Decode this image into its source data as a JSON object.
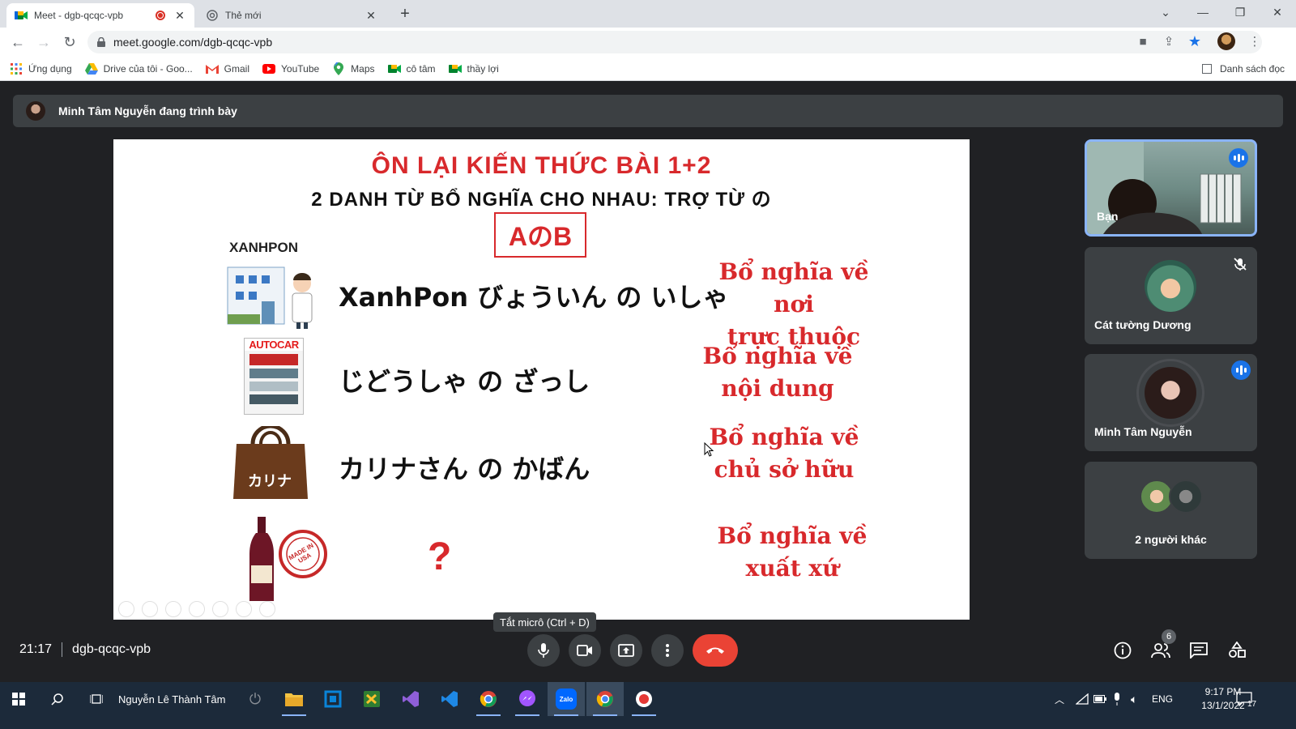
{
  "browser": {
    "tabs": [
      {
        "title": "Meet - dgb-qcqc-vpb",
        "active": true,
        "recording": true
      },
      {
        "title": "Thẻ mới",
        "active": false
      }
    ],
    "url": "meet.google.com/dgb-qcqc-vpb",
    "bookmarks": [
      {
        "label": "Ứng dụng",
        "icon": "apps-grid-icon"
      },
      {
        "label": "Drive của tôi - Goo...",
        "icon": "drive-icon"
      },
      {
        "label": "Gmail",
        "icon": "gmail-icon"
      },
      {
        "label": "YouTube",
        "icon": "youtube-icon"
      },
      {
        "label": "Maps",
        "icon": "maps-icon"
      },
      {
        "label": "cô tâm",
        "icon": "meet-icon"
      },
      {
        "label": "thầy lợi",
        "icon": "meet-icon"
      }
    ],
    "reading_list": "Danh sách đọc"
  },
  "meet": {
    "presenter_text": "Minh Tâm Nguyễn đang trình bày",
    "slide": {
      "title1": "ÔN LẠI KIẾN THỨC BÀI 1+2",
      "title2": "2 DANH TỪ BỔ NGHĨA CHO NHAU: TRỢ TỪ の",
      "box": "AのB",
      "xanhpon_label": "XANHPON",
      "rows": [
        {
          "jp": "XanhPon びょういん の いしゃ",
          "note1": "Bổ nghĩa về nơi",
          "note2": "trực thuộc"
        },
        {
          "jp": "じどうしゃ の ざっし",
          "note1": "Bổ nghĩa về",
          "note2": "nội dung"
        },
        {
          "jp": "カリナさん の かばん",
          "note1": "Bổ nghĩa về",
          "note2": "chủ sở hữu"
        },
        {
          "jp": "?",
          "note1": "Bổ nghĩa về",
          "note2": "xuất xứ"
        }
      ],
      "autocar_label": "AUTOCAR",
      "bag_label": "カリナ",
      "stamp_label": "MADE IN USA"
    },
    "participants": [
      {
        "name": "Bạn",
        "speaking": true
      },
      {
        "name": "Cát tường Dương",
        "muted": true
      },
      {
        "name": "Minh Tâm Nguyễn",
        "speaking": true
      },
      {
        "name": "2 người khác"
      }
    ],
    "time": "21:17",
    "meeting_code": "dgb-qcqc-vpb",
    "tooltip": "Tắt micrô (Ctrl + D)",
    "people_count": "6"
  },
  "taskbar": {
    "user": "Nguyễn Lê Thành Tâm",
    "lang": "ENG",
    "clock_time": "9:17 PM",
    "clock_date": "13/1/2022",
    "notifications": "17"
  },
  "colors": {
    "accent": "#1a73e8",
    "end_call": "#ea4335",
    "slide_red": "#d8292c"
  }
}
